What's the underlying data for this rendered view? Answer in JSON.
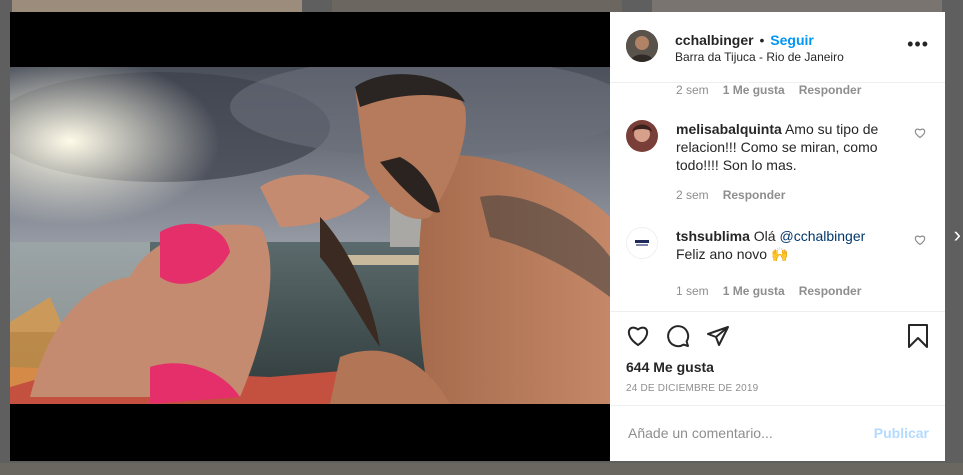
{
  "post": {
    "username": "cchalbinger",
    "separator": "•",
    "follow_label": "Seguir",
    "location": "Barra da Tijuca - Rio de Janeiro",
    "more_icon": "more-options-icon",
    "likes": "644 Me gusta",
    "date": "24 DE DICIEMBRE DE 2019"
  },
  "first_meta": {
    "time": "2 sem",
    "likes": "1 Me gusta",
    "reply": "Responder"
  },
  "comments": [
    {
      "username": "melisabalquinta",
      "text": "Amo su tipo de relacion!!! Como se miran, como todo!!!! Son lo mas.",
      "time": "2 sem",
      "reply": "Responder"
    },
    {
      "username": "tshsublima",
      "text_prefix": "Olá",
      "mention": "@cchalbinger",
      "text_suffix": "Feliz ano novo 🙌",
      "time": "1 sem",
      "likes": "1 Me gusta",
      "reply": "Responder"
    }
  ],
  "add_comment": {
    "placeholder": "Añade un comentario...",
    "publish": "Publicar"
  },
  "icons": [
    "like-icon",
    "comment-icon",
    "share-icon",
    "save-icon",
    "user-tag-icon",
    "next-arrow-icon"
  ]
}
